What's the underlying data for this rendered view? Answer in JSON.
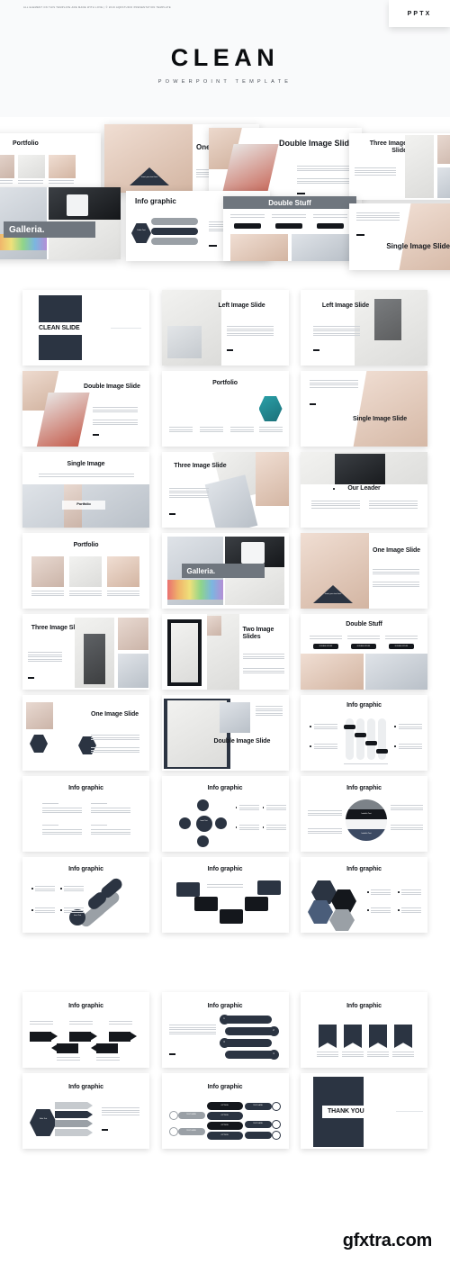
{
  "header": {
    "credit": "ALL ELEMENT ON THIS TEMPLATE ARE MADE WITH LOVE | © 2019 AQRSTUDIO PRESENTATION TEMPLATE",
    "badge": "PPTX",
    "title": "CLEAN",
    "subtitle": "POWERPOINT TEMPLATE"
  },
  "hero_montage": {
    "slides": [
      {
        "title": "Portfolio"
      },
      {
        "title": "One Imag Slide",
        "overlay": "Insert your text here"
      },
      {
        "title": "Double Image Slide"
      },
      {
        "title": "Three Image Slide"
      },
      {
        "title": "Galleria."
      },
      {
        "title": "Info graphic",
        "badge": "Delta Text"
      },
      {
        "title": "Double Stuff"
      },
      {
        "title": "Single Image Slide"
      }
    ]
  },
  "grid": {
    "rows": [
      {
        "cards": [
          {
            "title": "CLEAN SLIDE",
            "layout": "cover"
          },
          {
            "title": "Left Image Slide",
            "layout": "left-image"
          },
          {
            "title": "Left Image Slide",
            "layout": "left-image-alt"
          }
        ]
      },
      {
        "cards": [
          {
            "title": "Double Image Slide",
            "layout": "double-image"
          },
          {
            "title": "Portfolio",
            "layout": "portfolio-hex"
          },
          {
            "title": "Single Image Slide",
            "layout": "single-image-diag"
          }
        ]
      },
      {
        "cards": [
          {
            "title": "Single Image",
            "layout": "single-image-band",
            "badge": "Portfolio"
          },
          {
            "title": "Three Image Slide",
            "layout": "three-image-diag"
          },
          {
            "title": "Our Leader",
            "layout": "our-leader"
          }
        ]
      },
      {
        "cards": [
          {
            "title": "Portfolio",
            "layout": "portfolio-three"
          },
          {
            "title": "Galleria.",
            "layout": "galleria"
          },
          {
            "title": "One Image Slide",
            "layout": "one-image-tri",
            "overlay": "Insert your text here"
          }
        ]
      },
      {
        "cards": [
          {
            "title": "Three Image Slide",
            "layout": "three-image-grid"
          },
          {
            "title": "Two Image Slides",
            "layout": "two-image"
          },
          {
            "title": "Double Stuff",
            "layout": "double-stuff",
            "buttons": [
              "DOUBLE STUFF",
              "DOUBLE STUFF",
              "DOUBLE STUFF"
            ]
          }
        ]
      },
      {
        "cards": [
          {
            "title": "One Image Slide",
            "layout": "one-image-hex"
          },
          {
            "title": "Double Image Slide",
            "layout": "double-image-frame"
          },
          {
            "title": "Info graphic",
            "layout": "info-bars"
          }
        ]
      },
      {
        "cards": [
          {
            "title": "Info graphic",
            "layout": "info-text-quad"
          },
          {
            "title": "Info graphic",
            "layout": "info-circle-cluster",
            "center": "Insert Text"
          },
          {
            "title": "Info graphic",
            "layout": "info-sphere",
            "bands": [
              "Isabella Text",
              "Isabella Text"
            ]
          }
        ]
      },
      {
        "cards": [
          {
            "title": "Info graphic",
            "layout": "info-capsules",
            "badge": "Insert Text"
          },
          {
            "title": "Info graphic",
            "layout": "info-tree"
          },
          {
            "title": "Info graphic",
            "layout": "info-hex-cluster"
          }
        ]
      },
      {
        "cards": [
          {
            "title": "Info graphic",
            "layout": "info-arrows"
          },
          {
            "title": "Info graphic",
            "layout": "info-numbered-bars",
            "numbers": [
              "1",
              "2",
              "3",
              "4"
            ]
          },
          {
            "title": "Info graphic",
            "layout": "info-banners"
          }
        ]
      },
      {
        "cards": [
          {
            "title": "Info graphic",
            "layout": "info-hex-arrows",
            "badge": "Delta Text"
          },
          {
            "title": "Info graphic",
            "layout": "info-cylinders",
            "options": [
              "OPTION",
              "OPTION",
              "OPTION",
              "OPTION"
            ],
            "tags": [
              "TEXT HERE",
              "TEXT HERE",
              "TEXT HERE",
              "TEXT HERE"
            ]
          },
          {
            "title": "THANK YOU",
            "layout": "thank-you"
          }
        ]
      }
    ]
  },
  "footer": {
    "watermark": "gfxtra.com"
  },
  "colors": {
    "navy": "#2b3442",
    "black": "#14171c",
    "grey": "#9aa0a6",
    "blue": "#4a5d7a",
    "page_bg": "#ffffff",
    "header_bg": "#f9fafb"
  }
}
